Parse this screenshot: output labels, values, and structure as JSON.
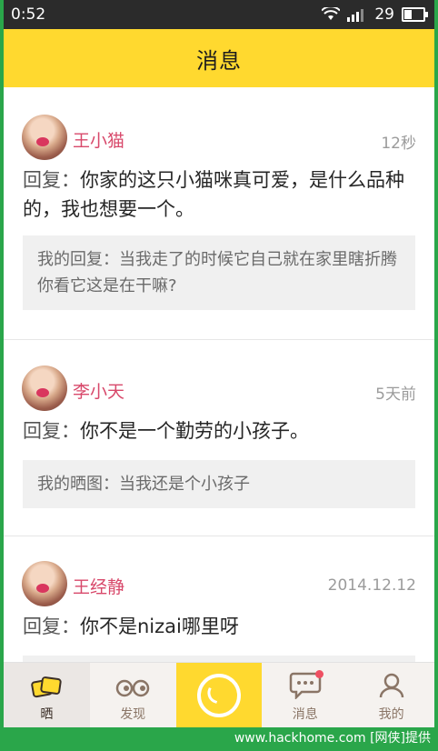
{
  "status_bar": {
    "time": "0:52",
    "battery": "29"
  },
  "header": {
    "title": "消息"
  },
  "messages": [
    {
      "name": "王小猫",
      "time": "12秒",
      "reply_prefix": "回复：",
      "reply": "你家的这只小猫咪真可爱，是什么品种的，我也想要一个。",
      "quote": "我的回复：当我走了的时候它自己就在家里瞎折腾你看它这是在干嘛?"
    },
    {
      "name": "李小天",
      "time": "5天前",
      "reply_prefix": "回复：",
      "reply": "你不是一个勤劳的小孩子。",
      "quote": "我的晒图：当我还是个小孩子"
    },
    {
      "name": "王经静",
      "time": "2014.12.12",
      "reply_prefix": "回复：",
      "reply": "你不是nizai哪里呀",
      "quote": ""
    }
  ],
  "tabs": [
    {
      "label": "晒"
    },
    {
      "label": "发现"
    },
    {
      "label": ""
    },
    {
      "label": "消息"
    },
    {
      "label": "我的"
    }
  ],
  "watermark": "www.hackhome.com [网侠]提供",
  "colors": {
    "accent": "#ffd92f",
    "name": "#d8496b",
    "badge": "#ef5062"
  }
}
